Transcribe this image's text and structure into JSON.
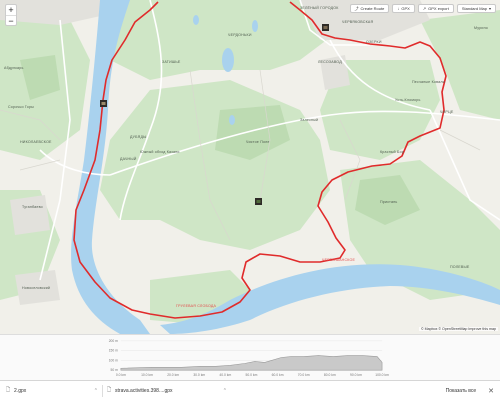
{
  "map": {
    "zoom_in": "+",
    "zoom_out": "−",
    "toolbar": {
      "create_route": "Create Route",
      "gpx": "GPX",
      "gpx_export": "GPX export",
      "map_style": "Standard Map"
    },
    "attribution": "© Mapbox © OpenStreetMap Improve this map",
    "labels": [
      {
        "text": "ЧЕРДОНЬКИ",
        "cls": ""
      },
      {
        "text": "ЧЕРВЯКОВСКАЯ",
        "cls": ""
      },
      {
        "text": "ЗЕЛЁНЫЙ ГОРОДОК",
        "cls": "green"
      },
      {
        "text": "ЛЕСОЗАВОД",
        "cls": ""
      },
      {
        "text": "ЗАТИШЬЕ",
        "cls": ""
      },
      {
        "text": "ОЗЕРКИ",
        "cls": ""
      },
      {
        "text": "Мурино",
        "cls": ""
      },
      {
        "text": "ЧИРЦЕ",
        "cls": ""
      },
      {
        "text": "Усть-Кломорь",
        "cls": ""
      },
      {
        "text": "Южный обход Казани",
        "cls": ""
      },
      {
        "text": "Залесный",
        "cls": ""
      },
      {
        "text": "ДАЧНЫЙ",
        "cls": ""
      },
      {
        "text": "НИКОЛАЕВСКОЕ",
        "cls": ""
      },
      {
        "text": "ДУБЯДЫ",
        "cls": ""
      },
      {
        "text": "Сорочьи Горы",
        "cls": ""
      },
      {
        "text": "ПОЛЕВЫЕ",
        "cls": ""
      },
      {
        "text": "Туганбаево",
        "cls": ""
      },
      {
        "text": "Новоселовский",
        "cls": ""
      },
      {
        "text": "Абдулкарь",
        "cls": ""
      },
      {
        "text": "Пристань",
        "cls": ""
      },
      {
        "text": "ГРУЛЕВАЯ СЛОБОДА",
        "cls": "red"
      },
      {
        "text": "ЧЕРЕМШАНСКОЕ",
        "cls": "red"
      },
      {
        "text": "Красный Бор",
        "cls": ""
      },
      {
        "text": "Песчаные Ковали",
        "cls": ""
      },
      {
        "text": "Чистое Поле",
        "cls": ""
      }
    ]
  },
  "elevation": {
    "y_ticks": [
      "200 m",
      "150 m",
      "100 m",
      "50 m"
    ],
    "x_ticks": [
      "0.0 km",
      "10.0 km",
      "20.0 km",
      "30.0 km",
      "40.0 km",
      "50.0 km",
      "60.0 km",
      "70.0 km",
      "80.0 km",
      "90.0 km",
      "100.0 km"
    ]
  },
  "downloads": {
    "items": [
      {
        "name": "2.gpx"
      },
      {
        "name": "strava.activities.398....gpx"
      }
    ],
    "show_all": "Показать все",
    "close": "✕"
  },
  "colors": {
    "route": "#e02b2b",
    "river": "#a9d2ee",
    "forest": "#cfe6c6",
    "land": "#f1f0ea"
  }
}
